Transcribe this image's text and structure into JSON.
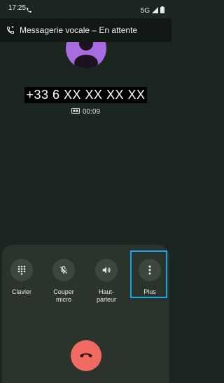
{
  "status": {
    "time": "17:25",
    "network": "5G"
  },
  "banner": {
    "text": "Messagerie vocale – En attente"
  },
  "call": {
    "number": "+33 6 XX XX XX XX",
    "duration": "00:09"
  },
  "buttons": {
    "keypad": "Clavier",
    "mute_line1": "Couper",
    "mute_line2": "micro",
    "speaker_line1": "Haut-",
    "speaker_line2": "parleur",
    "more": "Plus"
  },
  "colors": {
    "background": "#1c2620",
    "avatar": "#a86ce0",
    "hangup": "#f06a62",
    "highlight": "#1aa3e8"
  }
}
